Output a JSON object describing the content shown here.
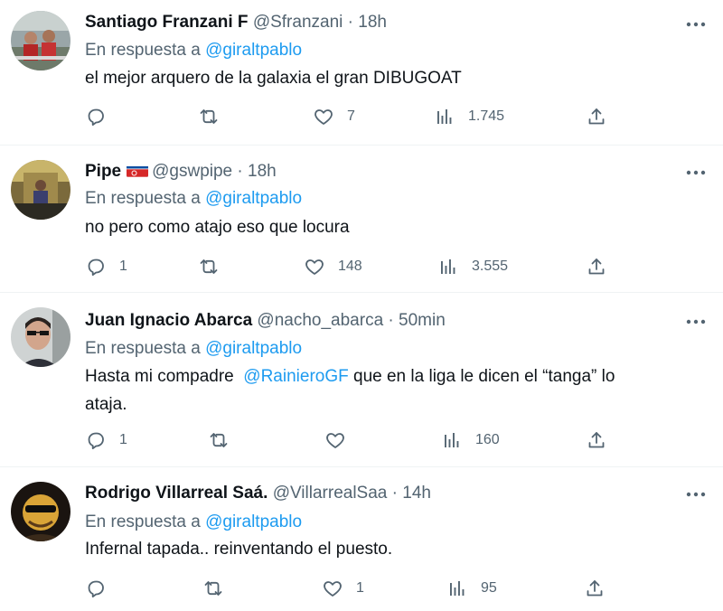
{
  "tweets": [
    {
      "name": "Santiago Franzani F",
      "handle": "@Sfranzani",
      "sep": "·",
      "time": "18h",
      "reply_prefix": "En respuesta a",
      "reply_to": "@giraltpablo",
      "text_parts": [
        "el mejor arquero de la galaxia el gran DIBUGOAT"
      ],
      "replies": "",
      "retweets": "",
      "likes": "7",
      "views": "1.745"
    },
    {
      "name": "Pipe",
      "flag": "north-korea-flag-emoji",
      "handle": "@gswpipe",
      "sep": "·",
      "time": "18h",
      "reply_prefix": "En respuesta a",
      "reply_to": "@giraltpablo",
      "text_parts": [
        "no pero como atajo eso que locura"
      ],
      "replies": "1",
      "retweets": "",
      "likes": "148",
      "views": "3.555"
    },
    {
      "name": "Juan Ignacio Abarca",
      "handle": "@nacho_abarca",
      "sep": "·",
      "time": "50min",
      "reply_prefix": "En respuesta a",
      "reply_to": "@giraltpablo",
      "text_line1_before": "Hasta mi compadre",
      "text_mention": "@RainieroGF",
      "text_line1_after": "que en la liga le dicen el “tanga” lo",
      "text_line2": "ataja.",
      "replies": "1",
      "retweets": "",
      "likes": "",
      "views": "160"
    },
    {
      "name": "Rodrigo Villarreal Saá.",
      "handle": "@VillarrealSaa",
      "sep": "·",
      "time": "14h",
      "reply_prefix": "En respuesta a",
      "reply_to": "@giraltpablo",
      "text_parts": [
        "Infernal tapada.. reinventando el puesto."
      ],
      "replies": "",
      "retweets": "",
      "likes": "1",
      "views": "95"
    }
  ],
  "icons": {
    "reply": "reply-bubble-icon",
    "retweet": "retweet-icon",
    "like": "heart-icon",
    "views": "views-bar-chart-icon",
    "share": "share-upload-icon",
    "more": "more-dots-icon"
  },
  "colors": {
    "text": "#0f1419",
    "secondary": "#536471",
    "link": "#1d9bf0",
    "divider": "#eff3f4"
  }
}
